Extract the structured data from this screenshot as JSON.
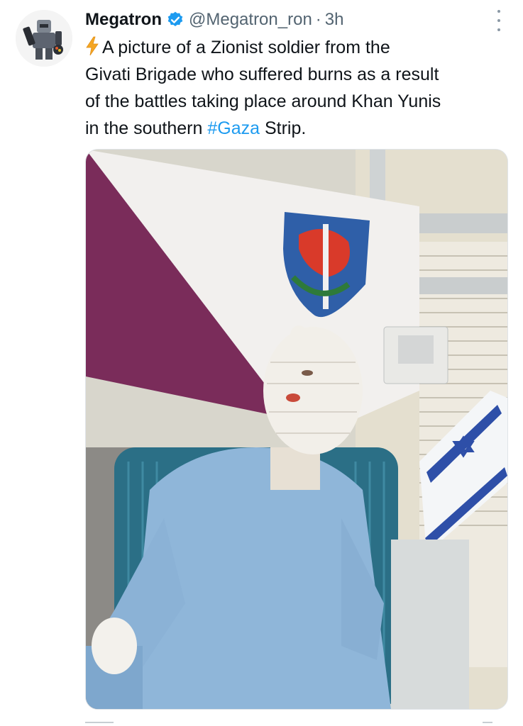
{
  "tweet": {
    "author_name": "Megatron",
    "handle": "@Megatron_ron",
    "separator": "·",
    "time": "3h",
    "text_line_1": "A picture of a Zionist soldier from the",
    "text_line_2": "Givati Brigade who suffered burns as a result",
    "text_line_3": "of the battles taking place around Khan Yunis",
    "text_line_4_before": "in the southern ",
    "hashtag": "#Gaza",
    "text_line_4_after": " Strip."
  },
  "icons": {
    "verified": "verified-badge-icon",
    "lightning": "lightning-bolt-icon",
    "more": "more-options-icon"
  },
  "colors": {
    "accent": "#1d9bf0",
    "text": "#0f1419",
    "secondary": "#536471"
  }
}
